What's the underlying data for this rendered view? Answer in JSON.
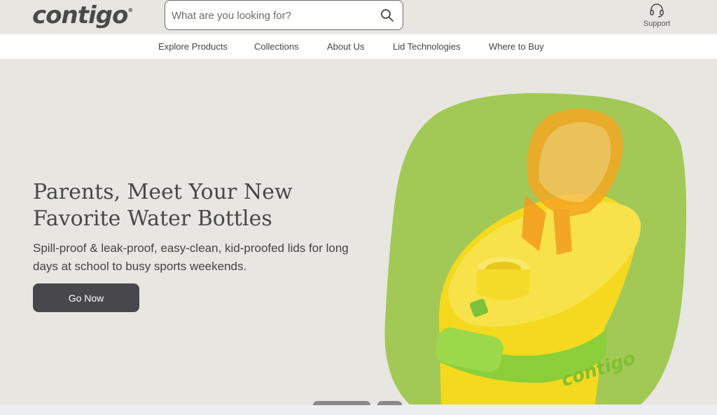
{
  "header": {
    "logo_text": "contigo",
    "logo_mark": "®",
    "search_placeholder": "What are you looking for?",
    "support_label": "Support"
  },
  "nav": {
    "items": [
      {
        "label": "Explore Products"
      },
      {
        "label": "Collections"
      },
      {
        "label": "About Us"
      },
      {
        "label": "Lid Technologies"
      },
      {
        "label": "Where to Buy"
      }
    ]
  },
  "hero": {
    "headline_line1": "Parents, Meet Your New",
    "headline_line2": "Favorite Water Bottles",
    "subtext": "Spill-proof & leak-proof, easy-clean, kid-proofed lids for long days at school to busy sports weekends.",
    "cta_label": "Go Now",
    "bottle_brand": "contigo"
  },
  "colors": {
    "background": "#e7e6e1",
    "nav_background": "#ffffff",
    "button": "#48474b",
    "green_blob": "#a2c955",
    "bottle_yellow": "#f4d91e",
    "lid_orange": "#f5a623"
  },
  "icons": {
    "search": "search-icon",
    "support": "headset-icon"
  }
}
